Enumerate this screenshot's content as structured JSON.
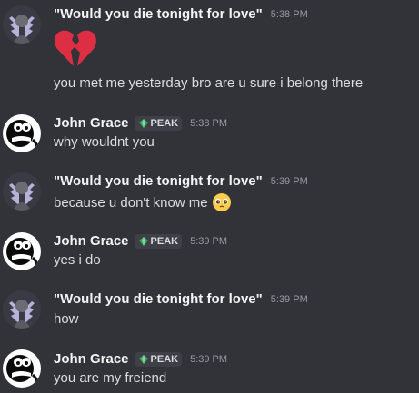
{
  "messages": [
    {
      "author": "\"Would you die tonight for love\"",
      "timestamp": "5:38 PM",
      "avatar": "angel-wings-avatar",
      "emoji": "broken-heart-icon",
      "content": "you met me yesterday bro are u sure i belong there"
    },
    {
      "author": "John Grace",
      "badge": "PEAK",
      "timestamp": "5:38 PM",
      "avatar": "character-avatar",
      "content": "why wouldnt you"
    },
    {
      "author": "\"Would you die tonight for love\"",
      "timestamp": "5:39 PM",
      "avatar": "angel-wings-avatar",
      "content": "because u don't know me",
      "trailing_emoji": "pleading-face-icon"
    },
    {
      "author": "John Grace",
      "badge": "PEAK",
      "timestamp": "5:39 PM",
      "avatar": "character-avatar",
      "content": "yes i do"
    },
    {
      "author": "\"Would you die tonight for love\"",
      "timestamp": "5:39 PM",
      "avatar": "angel-wings-avatar",
      "content": "how"
    },
    {
      "author": "John Grace",
      "badge": "PEAK",
      "timestamp": "5:39 PM",
      "avatar": "character-avatar",
      "content": "you are my freiend"
    }
  ],
  "new_messages_divider_color": "#e34a4a",
  "colors": {
    "background": "#323339",
    "username": "#f2f3f5",
    "message_text": "#dbdee1",
    "timestamp": "#949ba4",
    "badge_background": "#3f4047",
    "badge_gem": "#3ba55c"
  }
}
